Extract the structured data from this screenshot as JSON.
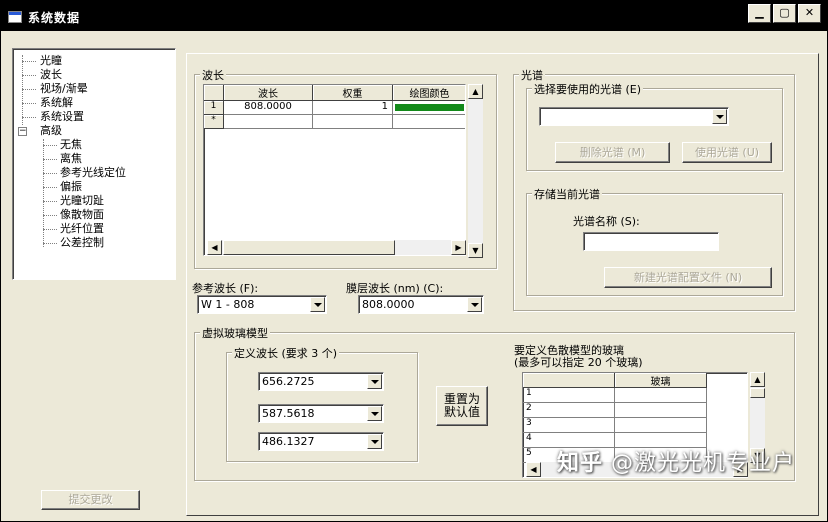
{
  "window": {
    "title": "系统数据",
    "buttons": {
      "minimize": "▁",
      "maximize": "▢",
      "close": "✕"
    }
  },
  "tree": {
    "items": [
      "光瞳",
      "波长",
      "视场/渐晕",
      "系统解",
      "系统设置",
      "高级"
    ],
    "expand_box": "−",
    "children": [
      "无焦",
      "离焦",
      "参考光线定位",
      "偏振",
      "光瞳切趾",
      "像散物面",
      "光纤位置",
      "公差控制"
    ]
  },
  "submit_button": "提交更改",
  "wavelength_group": {
    "label": "波长",
    "headers": [
      "波长",
      "权重",
      "绘图颜色"
    ],
    "rows": [
      {
        "index": "1",
        "wavelength": "808.0000",
        "weight": "1",
        "color": "#138a1a"
      },
      {
        "index": "*",
        "wavelength": "",
        "weight": "",
        "color": ""
      }
    ]
  },
  "spectrum_group": {
    "label": "光谱",
    "select_label": "选择要使用的光谱 (E)",
    "select_value": "",
    "delete_button": "删除光谱 (M)",
    "use_button": "使用光谱 (U)",
    "save_label": "存储当前光谱",
    "name_label": "光谱名称 (S):",
    "name_value": "",
    "new_button": "新建光谱配置文件 (N)"
  },
  "reference": {
    "label": "参考波长 (F):",
    "value": "W 1 - 808"
  },
  "coating": {
    "label": "膜层波长 (nm) (C):",
    "value": "808.0000"
  },
  "virtual_glass": {
    "label": "虚拟玻璃模型",
    "define_label": "定义波长 (要求 3 个)",
    "wavelengths": [
      "656.2725",
      "587.5618",
      "486.1327"
    ],
    "reset_button": "重置为\n默认值",
    "glass_label_line1": "要定义色散模型的玻璃",
    "glass_label_line2": "(最多可以指定 20 个玻璃)",
    "glass_header": "玻璃",
    "glass_rows": [
      "1",
      "2",
      "3",
      "4",
      "5"
    ]
  },
  "watermark": {
    "logo": "知乎",
    "text": "@激光光机专业户"
  }
}
